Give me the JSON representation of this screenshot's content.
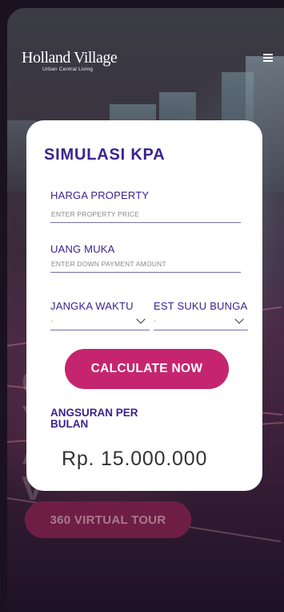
{
  "header": {
    "brand_name": "Holland Village",
    "brand_tagline": "Urban Central Living",
    "menu_icon": "hamburger-menu-icon"
  },
  "background": {
    "headline": "C\nY\nA\nV",
    "tour_button_label": "360 VIRTUAL TOUR"
  },
  "calculator": {
    "title": "SIMULASI KPA",
    "property_price": {
      "label": "HARGA PROPERTY",
      "placeholder": "ENTER PROPERTY PRICE",
      "value": ""
    },
    "down_payment": {
      "label": "UANG MUKA",
      "placeholder": "ENTER DOWN PAYMENT AMOUNT",
      "value": ""
    },
    "term": {
      "label": "JANGKA WAKTU",
      "selected": "-"
    },
    "interest_rate": {
      "label": "EST SUKU BUNGA",
      "selected": "-"
    },
    "calculate_label": "CALCULATE NOW",
    "result_label": "ANGSURAN PER BULAN",
    "result_value": "Rp. 15.000.000"
  },
  "colors": {
    "primary_purple": "#3b2390",
    "accent_magenta": "#c5256f",
    "card_bg": "#ffffff"
  }
}
